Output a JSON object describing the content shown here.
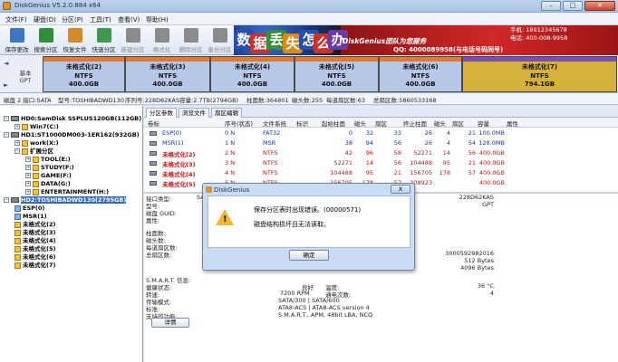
{
  "window": {
    "title": "DiskGenius V5.2.0.884 x64",
    "min": "–",
    "max": "□",
    "close": "✕"
  },
  "menu": [
    "文件(F)",
    "硬盘(D)",
    "分区(P)",
    "工具(T)",
    "查看(V)",
    "帮助(H)"
  ],
  "toolbar": [
    {
      "label": "保存更改",
      "icon": "save-icon",
      "color": "#3a77c7",
      "enabled": true
    },
    {
      "label": "搜索分区",
      "icon": "search-partition-icon",
      "color": "#2f8e3a",
      "enabled": true
    },
    {
      "label": "恢复文件",
      "icon": "recover-files-icon",
      "color": "#d4892b",
      "enabled": true
    },
    {
      "label": "快速分区",
      "icon": "quick-partition-icon",
      "color": "#3b9a4d",
      "enabled": true
    },
    {
      "label": "新建分区",
      "icon": "new-partition-icon",
      "color": "#8c8c8c",
      "enabled": false
    },
    {
      "label": "格式化",
      "icon": "format-icon",
      "color": "#8c8c8c",
      "enabled": false
    },
    {
      "label": "删除分区",
      "icon": "delete-partition-icon",
      "color": "#8c8c8c",
      "enabled": false
    },
    {
      "label": "备份分区",
      "icon": "backup-partition-icon",
      "color": "#8c8c8c",
      "enabled": false
    }
  ],
  "banner": {
    "chars": [
      "数",
      "据",
      "丢",
      "失",
      "怎",
      "么",
      "办"
    ],
    "brand": "DiskGenius团队为您服务",
    "phone1": "手机: 18912345678",
    "phone2": "电话: 400-008-9958",
    "qq": "QQ: 4000089958(与电话号码同号)"
  },
  "disk_nav": {
    "up": "◄",
    "down": "►",
    "label_line1": "基本",
    "label_line2": "GPT"
  },
  "disk_partitions": [
    {
      "name": "未格式化(2)",
      "fs": "NTFS",
      "size": "400.0GB",
      "style": "blue"
    },
    {
      "name": "未格式化(3)",
      "fs": "NTFS",
      "size": "400.0GB",
      "style": "blue"
    },
    {
      "name": "未格式化(4)",
      "fs": "NTFS",
      "size": "400.0GB",
      "style": "blue"
    },
    {
      "name": "未格式化(5)",
      "fs": "NTFS",
      "size": "400.0GB",
      "style": "blue"
    },
    {
      "name": "未格式化(6)",
      "fs": "NTFS",
      "size": "400.0GB",
      "style": "blue"
    },
    {
      "name": "未格式化(7)",
      "fs": "NTFS",
      "size": "794.1GB",
      "style": "gold"
    }
  ],
  "disk_info": {
    "iface": "磁盘 2 接口:SATA",
    "model": "型号:TOSHIBADWD130",
    "serial": "序列号:228D62KAS",
    "capacity": "容量:2.7TB(2794GB)",
    "cylinders": "柱面数:364801",
    "heads": "磁头数:255",
    "sectors_per_track": "每道扇区数:63",
    "total_sectors": "总扇区数:5860533168"
  },
  "tree": [
    {
      "text": "HD0:SamDisk SSPLUS120GB(112GB)",
      "level": 0,
      "type": "disk",
      "box": "-"
    },
    {
      "text": "Win7(C:)",
      "level": 1,
      "type": "part",
      "box": "+"
    },
    {
      "text": "HD1:ST1000DM003-1ER162(932GB)",
      "level": 0,
      "type": "disk",
      "box": "-"
    },
    {
      "text": "work(X:)",
      "level": 1,
      "type": "part",
      "box": "+"
    },
    {
      "text": "扩展分区",
      "level": 1,
      "type": "part",
      "box": "-"
    },
    {
      "text": "TOOL(E:)",
      "level": 2,
      "type": "part",
      "box": "+"
    },
    {
      "text": "STUDY(F:)",
      "level": 2,
      "type": "part",
      "box": "+"
    },
    {
      "text": "GAME(F:)",
      "level": 2,
      "type": "part",
      "box": "+"
    },
    {
      "text": "DATA(G:)",
      "level": 2,
      "type": "part",
      "box": "+"
    },
    {
      "text": "ENTERTAINMENT(H:)",
      "level": 2,
      "type": "part",
      "box": "+"
    },
    {
      "text": "HD2:TOSHIBADWD130(2795GB)",
      "level": 0,
      "type": "disk",
      "box": "-",
      "selected": true
    },
    {
      "text": "ESP(0)",
      "level": 1,
      "type": "part-blue",
      "box": ""
    },
    {
      "text": "MSR(1)",
      "level": 1,
      "type": "part-blue",
      "box": ""
    },
    {
      "text": "未格式化(2)",
      "level": 1,
      "type": "part",
      "box": ""
    },
    {
      "text": "未格式化(3)",
      "level": 1,
      "type": "part",
      "box": ""
    },
    {
      "text": "未格式化(4)",
      "level": 1,
      "type": "part",
      "box": ""
    },
    {
      "text": "未格式化(5)",
      "level": 1,
      "type": "part",
      "box": ""
    },
    {
      "text": "未格式化(6)",
      "level": 1,
      "type": "part",
      "box": ""
    },
    {
      "text": "未格式化(7)",
      "level": 1,
      "type": "part",
      "box": ""
    }
  ],
  "tabs": [
    "分区参数",
    "浏览文件",
    "扇区编辑"
  ],
  "table": {
    "headers": [
      "卷标",
      "序号(状态)",
      "文件系统",
      "标识",
      "起始柱面",
      "磁头",
      "扇区",
      "终止柱面",
      "磁头",
      "扇区",
      "容量",
      "属性"
    ],
    "rows": [
      {
        "cells": [
          "ESP(0)",
          "0 N",
          "FAT32",
          "",
          "0",
          "32",
          "33",
          "26",
          "4",
          "21",
          "100.0MB",
          ""
        ],
        "color": "blue"
      },
      {
        "cells": [
          "MSR(1)",
          "1 N",
          "MSR",
          "",
          "38",
          "94",
          "56",
          "26",
          "4",
          "54",
          "128.0MB",
          ""
        ],
        "color": "blue"
      },
      {
        "cells": [
          "未格式化(2)",
          "2 N",
          "NTFS",
          "",
          "42",
          "96",
          "58",
          "52271",
          "14",
          "56",
          "400.0GB",
          ""
        ],
        "color": "red"
      },
      {
        "cells": [
          "未格式化(3)",
          "3 N",
          "NTFS",
          "",
          "52271",
          "14",
          "56",
          "104488",
          "95",
          "21",
          "400.0GB",
          ""
        ],
        "color": "red"
      },
      {
        "cells": [
          "未格式化(4)",
          "4 N",
          "NTFS",
          "",
          "104488",
          "95",
          "21",
          "156705",
          "178",
          "57",
          "400.0GB",
          ""
        ],
        "color": "red"
      },
      {
        "cells": [
          "未格式化(5)",
          "5 N",
          "NTFS",
          "",
          "156705",
          "178",
          "57",
          "208923",
          "",
          "",
          "400.0GB",
          ""
        ],
        "color": "red"
      }
    ]
  },
  "detail": {
    "iface_label": "接口类型:",
    "iface_val": "SATA",
    "model_label": "型号:",
    "serial_val": "228D62KAS",
    "guid_label": "磁盘 GUID:",
    "guid_type": "GPT",
    "attr_label": "属性:",
    "cyl_label": "柱面数:",
    "head_label": "磁头数:",
    "spt_label": "每道扇区数:",
    "total_label": "总扇区数:",
    "total_val": "3000592982016",
    "sector_size_val": "512 Bytes",
    "phys_sector_val": "4096 Bytes",
    "smart_title": "S.M.A.R.T. 信息:",
    "health_label": "健康状态:",
    "health_val": "良好",
    "temp_label": "温度:",
    "temp_val": "36 °C",
    "rpm_label": "转速:",
    "rpm_val": "7200 RPM",
    "power_label": "通电次数:",
    "power_val": "4",
    "transfer_label": "传输模式:",
    "transfer_val": "SATA/300 | SATA/600",
    "standard_label": "标准:",
    "standard_val": "ATA8-ACS | ATA8-ACS version 4",
    "features_label": "支持的功能:",
    "features_val": "S.M.A.R.T., APM, 48bit LBA, NCQ",
    "details_button": "详情"
  },
  "dialog": {
    "title": "DiskGenius",
    "close": "X",
    "message1": "保存分区表时出现错误。(00000571)",
    "message2": "磁盘结构损坏且无法读取。",
    "ok": "确定"
  }
}
